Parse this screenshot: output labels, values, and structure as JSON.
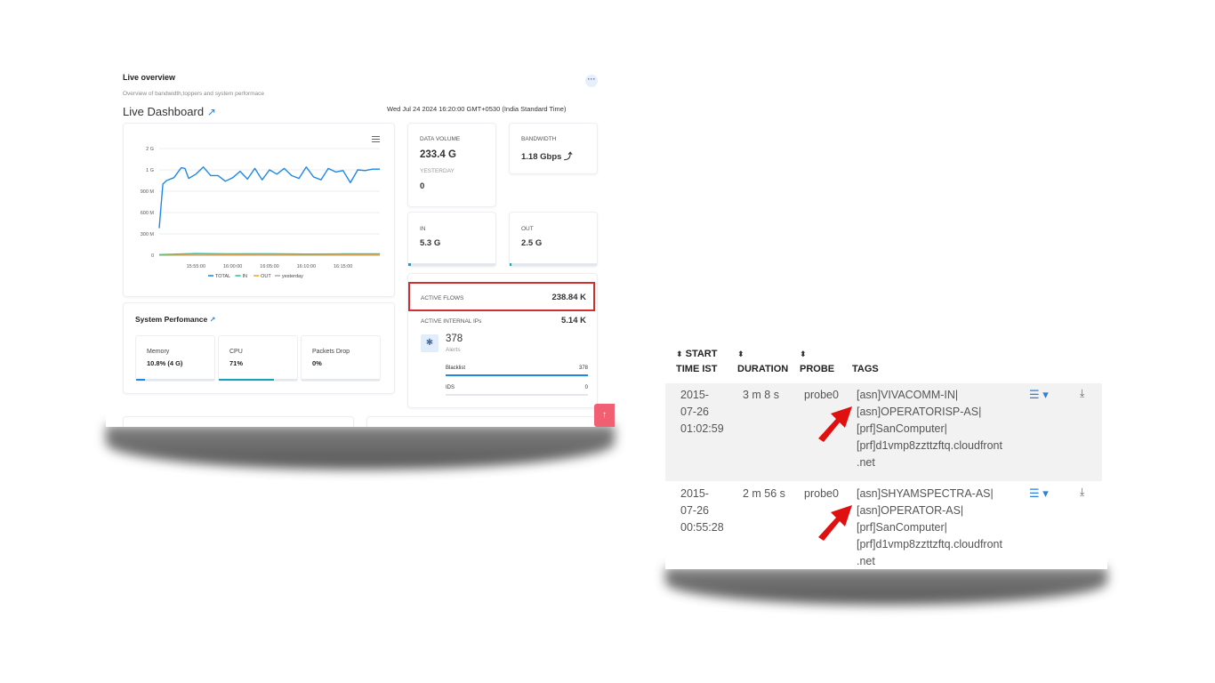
{
  "live_overview": {
    "title": "Live overview",
    "subtitle": "Overview of bandwidth,toppers and system performace",
    "menu_glyph": "···",
    "dashboard_title": "Live Dashboard",
    "timestamp": "Wed Jul 24 2024 16:20:00 GMT+0530 (India Standard Time)",
    "stats": {
      "data_volume_label": "DATA VOLUME",
      "data_volume_value": "233.4 G",
      "yesterday_label": "YESTERDAY",
      "yesterday_value": "0",
      "bandwidth_label": "BANDWIDTH",
      "bandwidth_value": "1.18 Gbps ⤴",
      "in_label": "IN",
      "in_value": "5.3 G",
      "in_progress": 0.03,
      "out_label": "OUT",
      "out_value": "2.5 G",
      "out_progress": 0.02
    },
    "flows": {
      "active_flows_label": "ACTIVE FLOWS",
      "active_flows_value": "238.84 K",
      "internal_ips_label": "ACTIVE INTERNAL IPs",
      "internal_ips_value": "5.14 K",
      "alerts_value": "378",
      "alerts_label": "Alerts",
      "blacklist_label": "Blacklist",
      "blacklist_value": "378",
      "blacklist_progress": 1.0,
      "ids_label": "IDS",
      "ids_value": "0",
      "ids_progress": 0
    },
    "system": {
      "title": "System Perfomance",
      "memory_label": "Memory",
      "memory_value": "10.8% (4 G)",
      "memory_progress": 0.108,
      "cpu_label": "CPU",
      "cpu_value": "71%",
      "cpu_progress": 0.71,
      "drop_label": "Packets Drop",
      "drop_value": "0%",
      "drop_progress": 0
    },
    "colors": {
      "accent": "#1e88e5",
      "teal": "#17a2b8",
      "highlight": "#d32f2f",
      "scroll_top": "#f06072"
    }
  },
  "chart_data": {
    "type": "line",
    "title": "",
    "xlabel": "",
    "ylabel": "",
    "y_tick_labels": [
      "0",
      "300 M",
      "600 M",
      "900 M",
      "1 G",
      "2 G"
    ],
    "y_tick_values": [
      0,
      300000000,
      600000000,
      900000000,
      1200000000,
      1500000000
    ],
    "x_tick_labels": [
      "15:55:00",
      "16:00:00",
      "16:05:00",
      "16:10:00",
      "16:15:00"
    ],
    "x_tick_values": [
      5,
      10,
      15,
      20,
      25
    ],
    "xlim": [
      0,
      30
    ],
    "ylim": [
      0,
      1500000000
    ],
    "grid": true,
    "legend": "bottom",
    "series": [
      {
        "name": "TOTAL",
        "color": "#1e88e5",
        "x": [
          0,
          0.5,
          1,
          2,
          3,
          3.5,
          4,
          5,
          6,
          7,
          8,
          9,
          10,
          11,
          12,
          13,
          14,
          15,
          16,
          17,
          18,
          19,
          20,
          21,
          22,
          23,
          24,
          25,
          26,
          27,
          28,
          29,
          30
        ],
        "values": [
          380000000,
          1000000000,
          1050000000,
          1090000000,
          1230000000,
          1220000000,
          1080000000,
          1140000000,
          1240000000,
          1120000000,
          1120000000,
          1040000000,
          1090000000,
          1180000000,
          1070000000,
          1220000000,
          1060000000,
          1200000000,
          1140000000,
          1220000000,
          1120000000,
          1080000000,
          1240000000,
          1100000000,
          1060000000,
          1220000000,
          1170000000,
          1190000000,
          1020000000,
          1200000000,
          1190000000,
          1210000000,
          1210000000
        ]
      },
      {
        "name": "IN",
        "color": "#26c6a0",
        "x": [
          0,
          5,
          10,
          15,
          20,
          25,
          30
        ],
        "values": [
          10000000,
          25000000,
          20000000,
          22000000,
          18000000,
          20000000,
          21000000
        ]
      },
      {
        "name": "OUT",
        "color": "#f5a623",
        "x": [
          0,
          5,
          10,
          15,
          20,
          25,
          30
        ],
        "values": [
          6000000,
          15000000,
          12000000,
          14000000,
          11000000,
          13000000,
          12000000
        ]
      },
      {
        "name": "yesterday",
        "color": "#b0b0b0",
        "x": [
          0,
          30
        ],
        "values": [
          0,
          0
        ]
      }
    ]
  },
  "table": {
    "headers": [
      {
        "line1": "START",
        "line2": "TIME IST",
        "sort": "⬍"
      },
      {
        "line1": "",
        "line2": "DURATION",
        "sort": "⬍"
      },
      {
        "line1": "",
        "line2": "PROBE",
        "sort": "⬍"
      },
      {
        "line1": "",
        "line2": "TAGS",
        "sort": ""
      }
    ],
    "rows": [
      {
        "start_1": "2015-",
        "start_2": "07-26",
        "start_3": "01:02:59",
        "duration": "3 m 8 s",
        "probe": "probe0",
        "tag_1": "[asn]VIVACOMM-IN|",
        "tag_2": "[asn]OPERATORISP-AS|",
        "tag_3": "[prf]SanComputer|",
        "tag_4": "[prf]d1vmp8zzttzftq.cloudfront",
        "tag_5": ".net",
        "actions_glyph": "☰ ▾",
        "download_glyph": "⤓"
      },
      {
        "start_1": "2015-",
        "start_2": "07-26",
        "start_3": "00:55:28",
        "duration": "2 m 56 s",
        "probe": "probe0",
        "tag_1": "[asn]SHYAMSPECTRA-AS|",
        "tag_2": "[asn]OPERATOR-AS|",
        "tag_3": "[prf]SanComputer|",
        "tag_4": "[prf]d1vmp8zzttzftq.cloudfront",
        "tag_5": ".net",
        "actions_glyph": "☰ ▾",
        "download_glyph": "⤓"
      }
    ],
    "arrow_color": "#e01010"
  }
}
